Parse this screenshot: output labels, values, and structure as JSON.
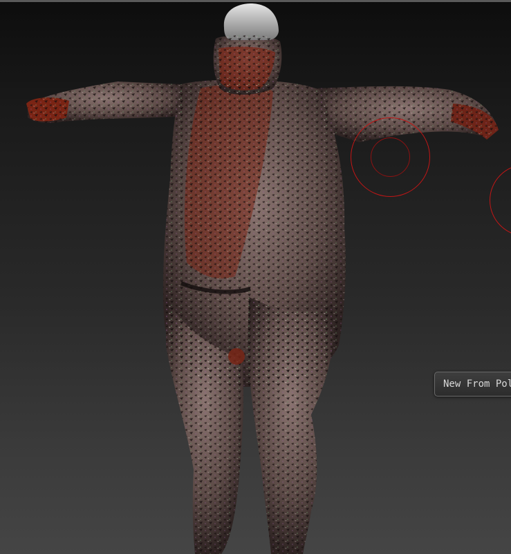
{
  "app": {
    "canvas": "3d-viewport",
    "background_gradient": [
      "#0d0d0d",
      "#454545"
    ]
  },
  "model": {
    "subject": "character-sculpt-tpose",
    "skin_color": "#6e5a55",
    "paint_color": "#7a2414",
    "noise_color": "#1a1212",
    "cap_color": "#c8c8c8"
  },
  "brush": {
    "color": "#c21616"
  },
  "tooltip": {
    "text": "New From Pol"
  }
}
